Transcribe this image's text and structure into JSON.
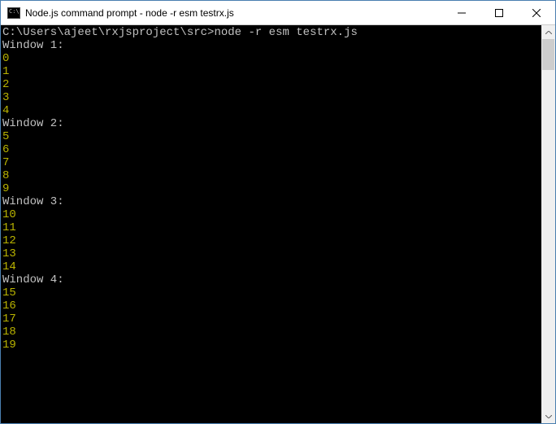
{
  "titlebar": {
    "title": "Node.js command prompt - node  -r esm testrx.js"
  },
  "terminal": {
    "prompt": "C:\\Users\\ajeet\\rxjsproject\\src>",
    "command": "node -r esm testrx.js",
    "groups": [
      {
        "label": "Window 1:",
        "values": [
          "0",
          "1",
          "2",
          "3",
          "4"
        ]
      },
      {
        "label": "Window 2:",
        "values": [
          "5",
          "6",
          "7",
          "8",
          "9"
        ]
      },
      {
        "label": "Window 3:",
        "values": [
          "10",
          "11",
          "12",
          "13",
          "14"
        ]
      },
      {
        "label": "Window 4:",
        "values": [
          "15",
          "16",
          "17",
          "18",
          "19"
        ]
      }
    ]
  },
  "controls": {
    "minimize": "minimize",
    "maximize": "maximize",
    "close": "close"
  }
}
